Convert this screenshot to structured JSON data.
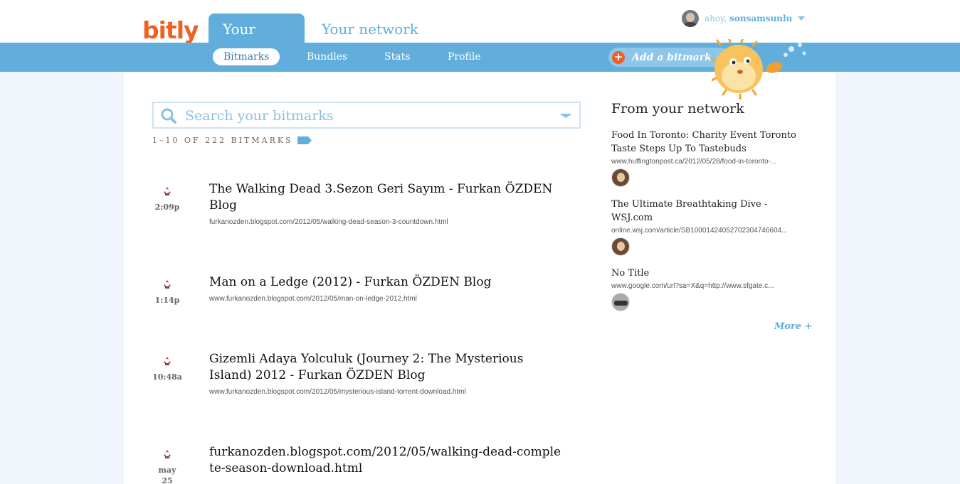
{
  "brand": {
    "logo_text": "bitly",
    "accent": "#ee6123",
    "primary": "#61aedd"
  },
  "header": {
    "tabs": [
      {
        "label": "Your stuff",
        "active": true
      },
      {
        "label": "Your network",
        "active": false
      }
    ],
    "user": {
      "greeting": "ahoy,",
      "username": "sonsamsunlu"
    }
  },
  "subnav": {
    "tabs": [
      {
        "label": "Bitmarks",
        "active": true
      },
      {
        "label": "Bundles"
      },
      {
        "label": "Stats"
      },
      {
        "label": "Profile"
      }
    ],
    "add_label": "Add a bitmark"
  },
  "search": {
    "placeholder": "Search your bitmarks"
  },
  "bitmark_count": "1–10 OF 222 BITMARKS",
  "bitmarks": [
    {
      "time": "2:09p",
      "title": "The Walking Dead 3.Sezon Geri Sayım - Furkan ÖZDEN Blog",
      "url": "furkanozden.blogspot.com/2012/05/walking-dead-season-3-countdown.html"
    },
    {
      "time": "1:14p",
      "title": "Man on a Ledge (2012) - Furkan ÖZDEN Blog",
      "url": "www.furkanozden.blogspot.com/2012/05/man-on-ledge-2012.html"
    },
    {
      "time": "10:48a",
      "title": "Gizemli Adaya Yolculuk (Journey 2: The Mysterious Island) 2012 - Furkan ÖZDEN Blog",
      "url": "www.furkanozden.blogspot.com/2012/05/mysterious-island-torrent-download.html"
    },
    {
      "time_line1": "may",
      "time_line2": "25",
      "title": "furkanozden.blogspot.com/2012/05/walking-dead-complete-season-download.html"
    }
  ],
  "sidebar": {
    "title": "From your network",
    "items": [
      {
        "title": "Food In Toronto: Charity Event Toronto Taste Steps Up To Tastebuds",
        "url": "www.huffingtonpost.ca/2012/05/28/food-in-toronto-..."
      },
      {
        "title": "The Ultimate Breathtaking Dive - WSJ.com",
        "url": "online.wsj.com/article/SB10001424052702304746604..."
      },
      {
        "title": "No Title",
        "url": "www.google.com/url?sa=X&q=http://www.sfgate.c..."
      }
    ],
    "more_label": "More +"
  }
}
